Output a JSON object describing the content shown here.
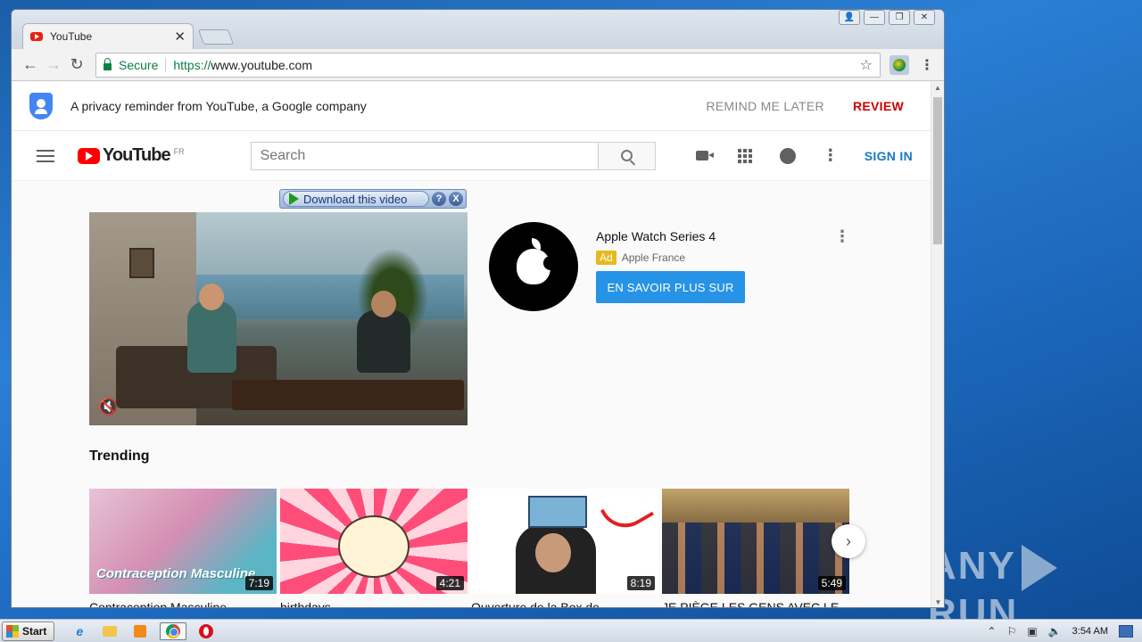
{
  "browser": {
    "tab_title": "YouTube",
    "tab_close": "✕",
    "secure_label": "Secure",
    "url_scheme": "https://",
    "url_host": "www.youtube.com",
    "window_controls": [
      "👤",
      "—",
      "❐",
      "✕"
    ]
  },
  "privacy": {
    "text": "A privacy reminder from YouTube, a Google company",
    "remind": "REMIND ME LATER",
    "review": "REVIEW"
  },
  "masthead": {
    "logo": "YouTube",
    "country": "FR",
    "search_placeholder": "Search",
    "signin": "SIGN IN"
  },
  "download_bar": {
    "label": "Download this video",
    "help": "?",
    "close": "X"
  },
  "ad": {
    "title": "Apple Watch Series 4",
    "badge": "Ad",
    "advertiser": "Apple France",
    "cta": "EN SAVOIR PLUS SUR"
  },
  "trending": {
    "heading": "Trending",
    "videos": [
      {
        "title": "Contraception Masculine",
        "duration": "7:19",
        "overlay": "Contraception Masculine"
      },
      {
        "title": "birthdays",
        "duration": "4:21"
      },
      {
        "title": "Ouverture de la Box de",
        "duration": "8:19"
      },
      {
        "title": "JE PIÈGE LES GENS AVEC LE",
        "duration": "5:49"
      }
    ]
  },
  "watermark": {
    "left": "ANY",
    "right": "RUN"
  },
  "taskbar": {
    "start": "Start",
    "clock": "3:54 AM"
  },
  "colors": {
    "youtube_red": "#ff0000",
    "review_red": "#cc0000",
    "signin_blue": "#167ac6",
    "cta_blue": "#2793e6",
    "ad_badge": "#e6b91e"
  },
  "icons": [
    "search-icon",
    "video-camera-icon",
    "apps-grid-icon",
    "messages-icon",
    "more-vert-icon",
    "hamburger-menu-icon",
    "shield-icon",
    "mute-icon",
    "chevron-right-icon"
  ]
}
